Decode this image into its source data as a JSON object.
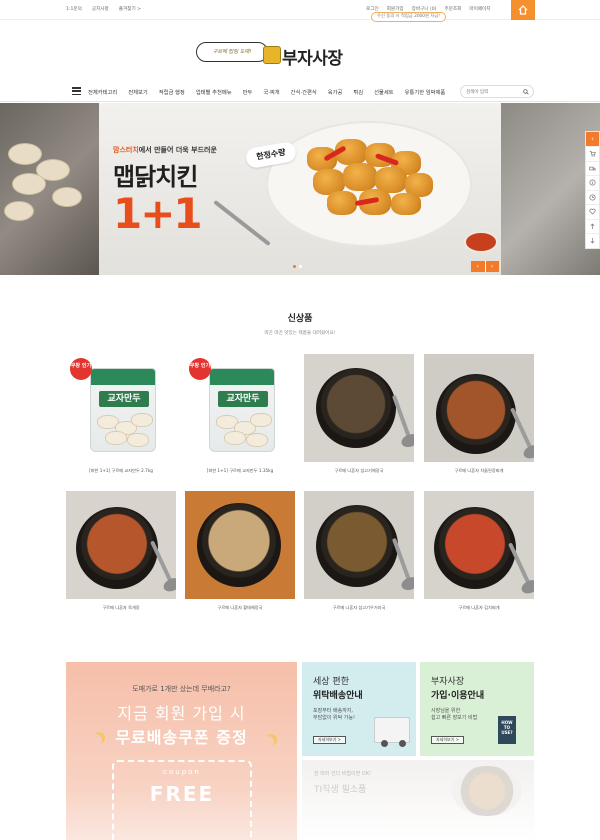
{
  "topbar": {
    "left_links": [
      "1:1문의",
      "공지사항",
      "즐겨찾기 >"
    ],
    "right_links": [
      "로그인",
      "회원가입",
      "장바구니 (0)",
      "주문조회",
      "마이페이지"
    ],
    "promo": "수신 동의 시 적립금 2000원 지급!"
  },
  "logo": {
    "tagline": "구르메 탑팀 도매!",
    "name": "부자사장"
  },
  "nav": {
    "items": [
      "전체카테고리",
      "전체보기",
      "적립금 행정",
      "업태별 추천메뉴",
      "만두",
      "국·찌개",
      "간식·간편식",
      "육가공",
      "튀김",
      "선물세트",
      "유통기한 임박제품"
    ],
    "search_placeholder": "검색어 입력"
  },
  "banner": {
    "sub_highlight": "맘스터치",
    "sub_rest": "에서 만들어 더욱 부드러운",
    "title": "맵닭치킨",
    "big": "1+1",
    "badge": "한정수량",
    "prev": "‹",
    "next": "›"
  },
  "quick_menu": {
    "top": "‹"
  },
  "new_products": {
    "title": "신상품",
    "subtitle": "따끈 따끈 맛있는 제품을 대려왔어요!",
    "items": [
      {
        "name": "[파한 1+1] 구르메 교자만두 2.7kg",
        "badge": "쿠팡 인기",
        "bag_label": "교자만두"
      },
      {
        "name": "[파한 1+1] 구르메 교자만두 1.35kg",
        "badge": "쿠팡 인기",
        "bag_label": "교자만두"
      },
      {
        "name": "구르메 나혼자 섬고기해장국"
      },
      {
        "name": "구르메 나혼자 차돌된장찌개"
      },
      {
        "name": "구르메 나혼자 육개장"
      },
      {
        "name": "구르메 나혼자 황태해장국"
      },
      {
        "name": "구르메 나혼자 섬고기우거지국"
      },
      {
        "name": "구르메 나혼자 김치찌개"
      }
    ]
  },
  "promo_banner": {
    "question": "도매가로 1개만 샀는데 무배라고?",
    "line1": "지금 회원 가입 시",
    "line2": "무료배송쿠폰 증정",
    "coupon_word": "coupon",
    "coupon_free": "FREE"
  },
  "card_delivery": {
    "title1": "세상 편한",
    "title2": "위탁배송안내",
    "desc1": "포장부터 배송까지,",
    "desc2": "부담없이 위탁 가능!",
    "button": "자세히보기 >"
  },
  "card_guide": {
    "title1": "부자사장",
    "title2": "가입·이용안내",
    "desc1": "사장님을 위한",
    "desc2": "쉽고 빠른 장보기 비법",
    "button": "자세히보기 >",
    "how": "HOW TO USE?"
  },
  "faded_banner": {
    "line1": "한 마리 건다 비법이면 OK!",
    "line2": "TI직생 필소품"
  },
  "colors": {
    "accent": "#f47a2b",
    "banner_red": "#e84e1b",
    "green": "#2c8a5a"
  }
}
